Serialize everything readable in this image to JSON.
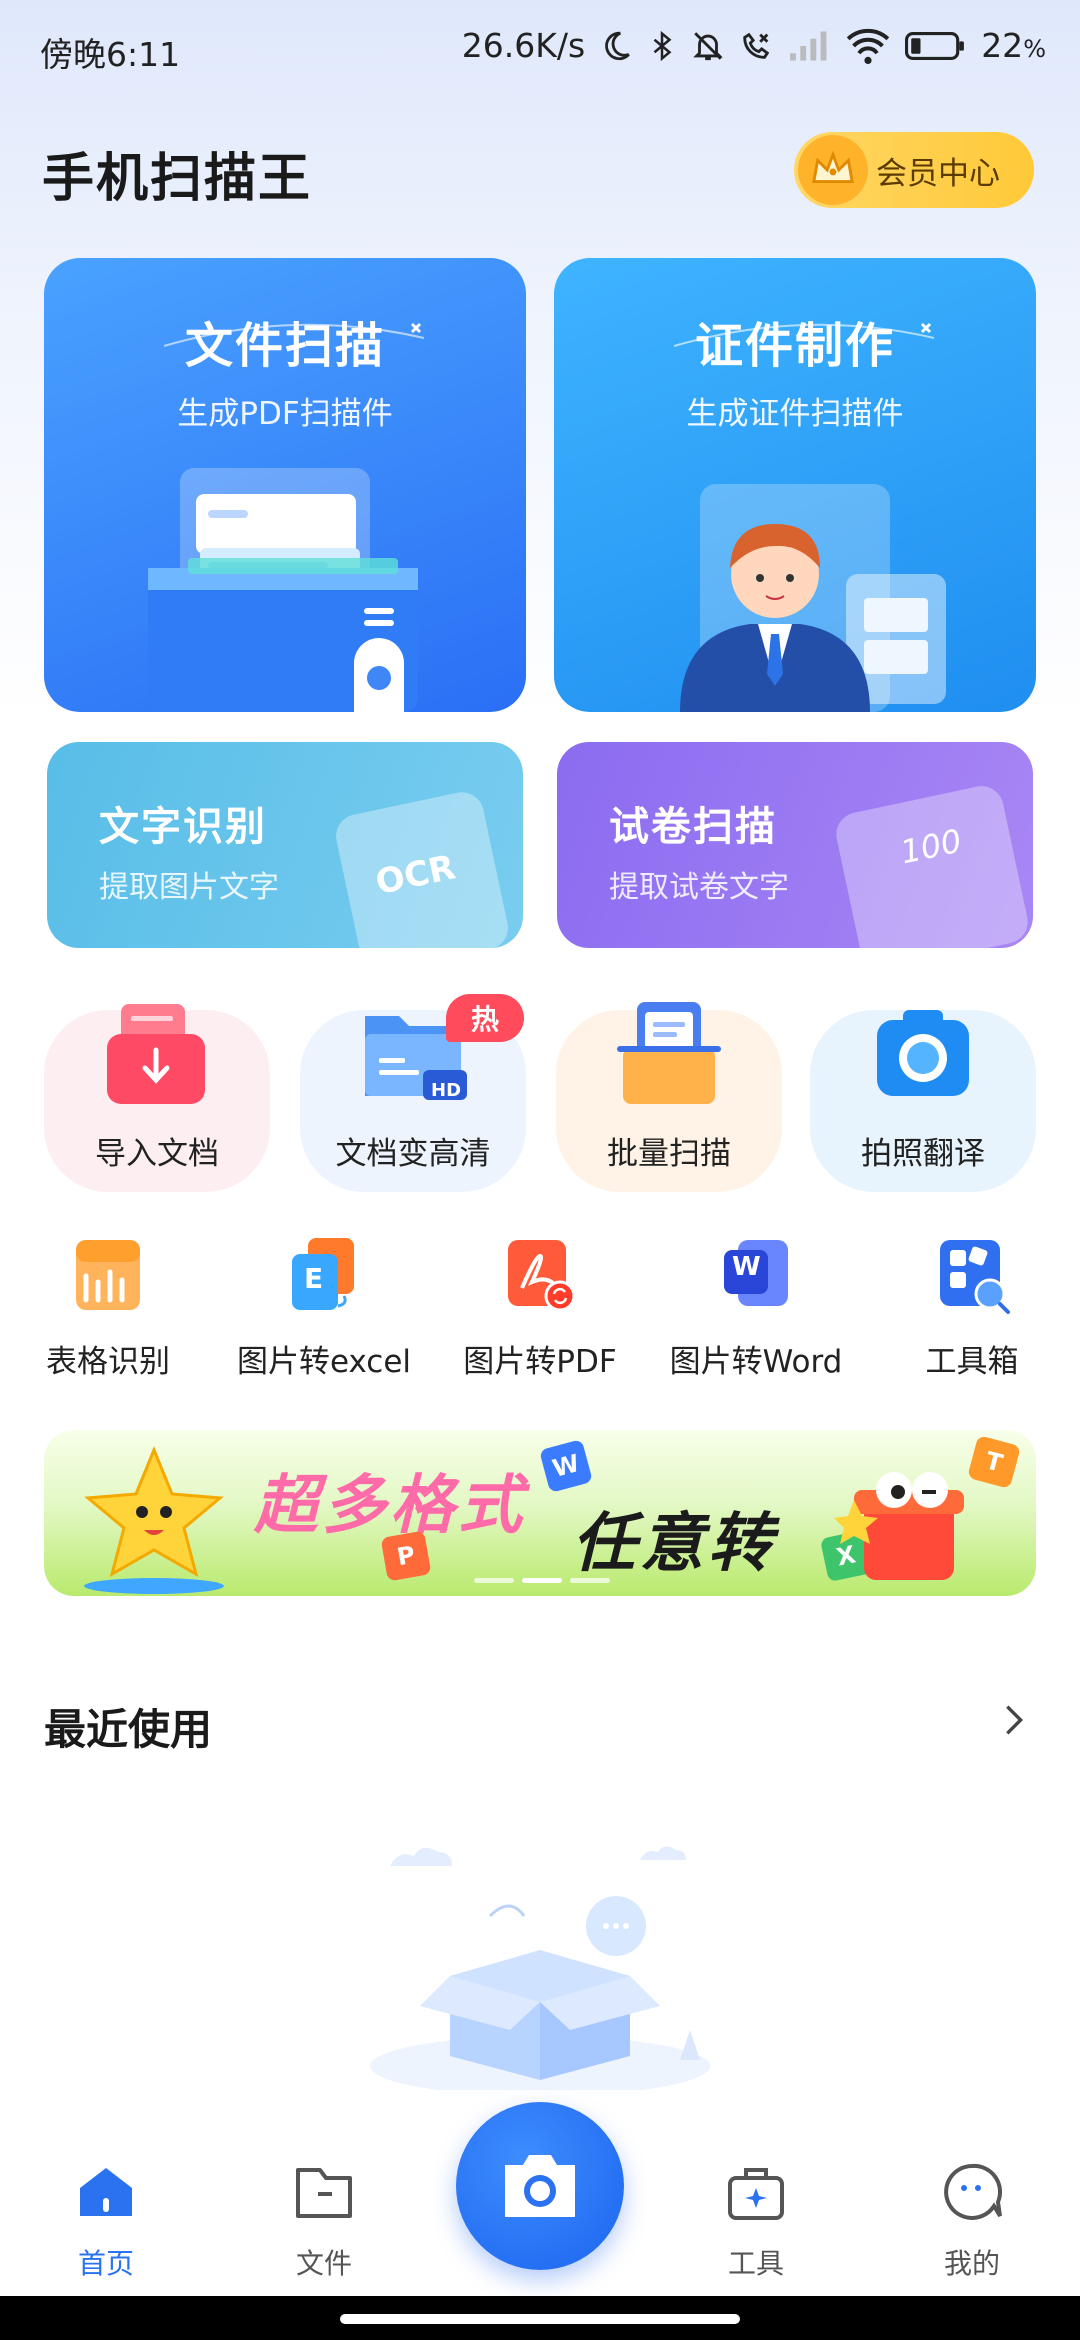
{
  "status_bar": {
    "time": "傍晚6:11",
    "network_speed": "26.6K/s",
    "battery": "22",
    "battery_unit": "%"
  },
  "header": {
    "title": "手机扫描王",
    "vip_label": "会员中心"
  },
  "feature_cards": {
    "doc_scan": {
      "title": "文件扫描",
      "subtitle": "生成PDF扫描件"
    },
    "id_make": {
      "title": "证件制作",
      "subtitle": "生成证件扫描件"
    },
    "ocr": {
      "title": "文字识别",
      "subtitle": "提取图片文字",
      "graphic_text": "OCR"
    },
    "exam": {
      "title": "试卷扫描",
      "subtitle": "提取试卷文字",
      "graphic_text": "100"
    }
  },
  "quick_tools": [
    {
      "label": "导入文档",
      "icon": "import-doc-icon"
    },
    {
      "label": "文档变高清",
      "icon": "hd-folder-icon",
      "badge": "热",
      "icon_text": "HD"
    },
    {
      "label": "批量扫描",
      "icon": "batch-scan-icon"
    },
    {
      "label": "拍照翻译",
      "icon": "camera-translate-icon"
    }
  ],
  "tools": [
    {
      "label": "表格识别",
      "icon": "table-recognize-icon"
    },
    {
      "label": "图片转excel",
      "icon": "image-to-excel-icon",
      "icon_text": "E"
    },
    {
      "label": "图片转PDF",
      "icon": "image-to-pdf-icon"
    },
    {
      "label": "图片转Word",
      "icon": "image-to-word-icon",
      "icon_text": "W"
    },
    {
      "label": "工具箱",
      "icon": "toolbox-icon"
    }
  ],
  "banner": {
    "text1": "超多格式",
    "text2": "任意转",
    "letters": [
      "W",
      "P",
      "T",
      "X"
    ],
    "active_slide": 2,
    "slide_count": 3
  },
  "recent": {
    "title": "最近使用"
  },
  "bottom_nav": [
    {
      "label": "首页",
      "icon": "home-icon",
      "active": true
    },
    {
      "label": "文件",
      "icon": "folder-icon",
      "active": false
    },
    {
      "label": "工具",
      "icon": "toolbag-icon",
      "active": false
    },
    {
      "label": "我的",
      "icon": "profile-icon",
      "active": false
    }
  ],
  "colors": {
    "accent": "#2a72f0",
    "vip_gold": "#ffc938",
    "hot_red": "#ff4b5c",
    "ocr_card": "#58bde7",
    "exam_card": "#8b6cf0"
  }
}
